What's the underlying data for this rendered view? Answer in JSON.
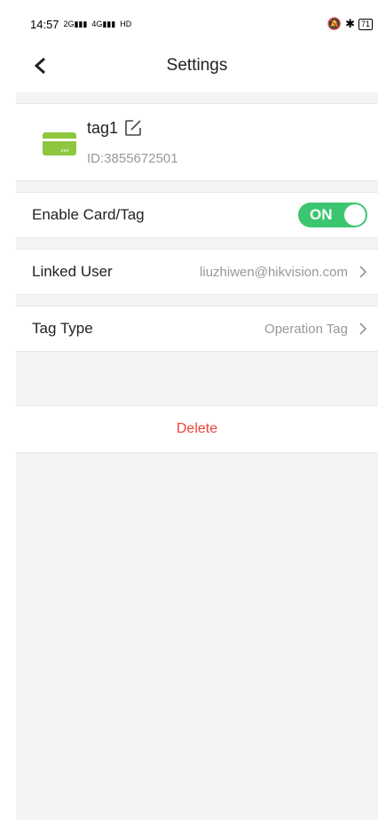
{
  "status_bar": {
    "time": "14:57",
    "signal1_tag": "2G",
    "signal2_tag": "4G",
    "network": "HD",
    "battery": "71"
  },
  "header": {
    "title": "Settings"
  },
  "tag": {
    "name": "tag1",
    "id_text": "ID:3855672501",
    "card_color": "#8ec63f"
  },
  "enable_row": {
    "label": "Enable Card/Tag",
    "toggle_label": "ON",
    "toggle_color": "#3cc66f"
  },
  "linked_user_row": {
    "label": "Linked User",
    "value": "liuzhiwen@hikvision.com"
  },
  "tag_type_row": {
    "label": "Tag Type",
    "value": "Operation Tag"
  },
  "delete": {
    "label": "Delete",
    "color": "#f0443a"
  }
}
